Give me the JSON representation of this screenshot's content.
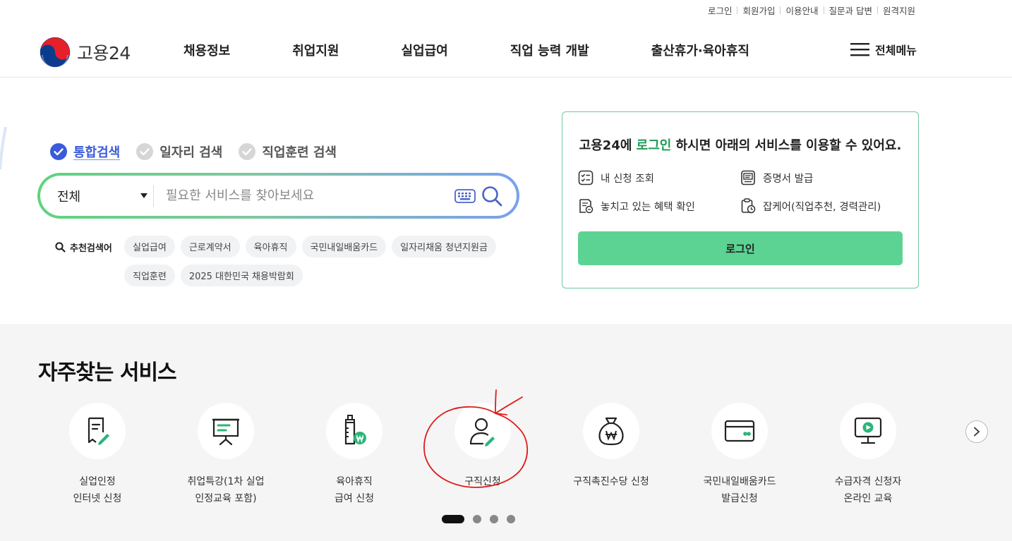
{
  "utility_links": [
    "로그인",
    "회원가입",
    "이용안내",
    "질문과 답변",
    "원격지원"
  ],
  "logo": {
    "text": "고용24"
  },
  "gnb": [
    "채용정보",
    "취업지원",
    "실업급여",
    "직업 능력 개발",
    "출산휴가·육아휴직"
  ],
  "all_menu_label": "전체메뉴",
  "search": {
    "tabs": [
      {
        "label": "통합검색",
        "active": true
      },
      {
        "label": "일자리 검색",
        "active": false
      },
      {
        "label": "직업훈련 검색",
        "active": false
      }
    ],
    "scope": "전체",
    "placeholder": "필요한 서비스를 찾아보세요",
    "recommend_title": "추천검색어",
    "keywords": [
      "실업급여",
      "근로계약서",
      "육아휴직",
      "국민내일배움카드",
      "일자리채움 청년지원금",
      "직업훈련",
      "2025 대한민국 채용박람회"
    ]
  },
  "login_card": {
    "msg_prefix": "고용24에 ",
    "msg_highlight": "로그인",
    "msg_suffix": " 하시면 아래의 서비스를 이용할 수 있어요.",
    "services": [
      "내 신청 조회",
      "증명서 발급",
      "놓치고 있는 혜택 확인",
      "잡케어(직업추천, 경력관리)"
    ],
    "button": "로그인"
  },
  "frequent": {
    "title": "자주찾는 서비스",
    "items": [
      {
        "label": "실업인정\n인터넷 신청",
        "icon": "document-pen-icon"
      },
      {
        "label": "취업특강(1차 실업\n인정교육 포함)",
        "icon": "presentation-board-icon"
      },
      {
        "label": "육아휴직\n급여 신청",
        "icon": "baby-bottle-won-icon"
      },
      {
        "label": "구직신청",
        "icon": "person-pen-icon"
      },
      {
        "label": "구직촉진수당 신청",
        "icon": "money-bag-won-icon"
      },
      {
        "label": "국민내일배움카드\n발급신청",
        "icon": "card-icon"
      },
      {
        "label": "수급자격 신청자\n온라인 교육",
        "icon": "monitor-play-icon"
      }
    ],
    "pagination": {
      "pages": 4,
      "current": 1
    }
  },
  "colors": {
    "brand_green": "#5dd393",
    "accent_blue": "#3b5bdb",
    "highlight_green": "#1e9a55",
    "annotation_red": "#e01b1b"
  }
}
